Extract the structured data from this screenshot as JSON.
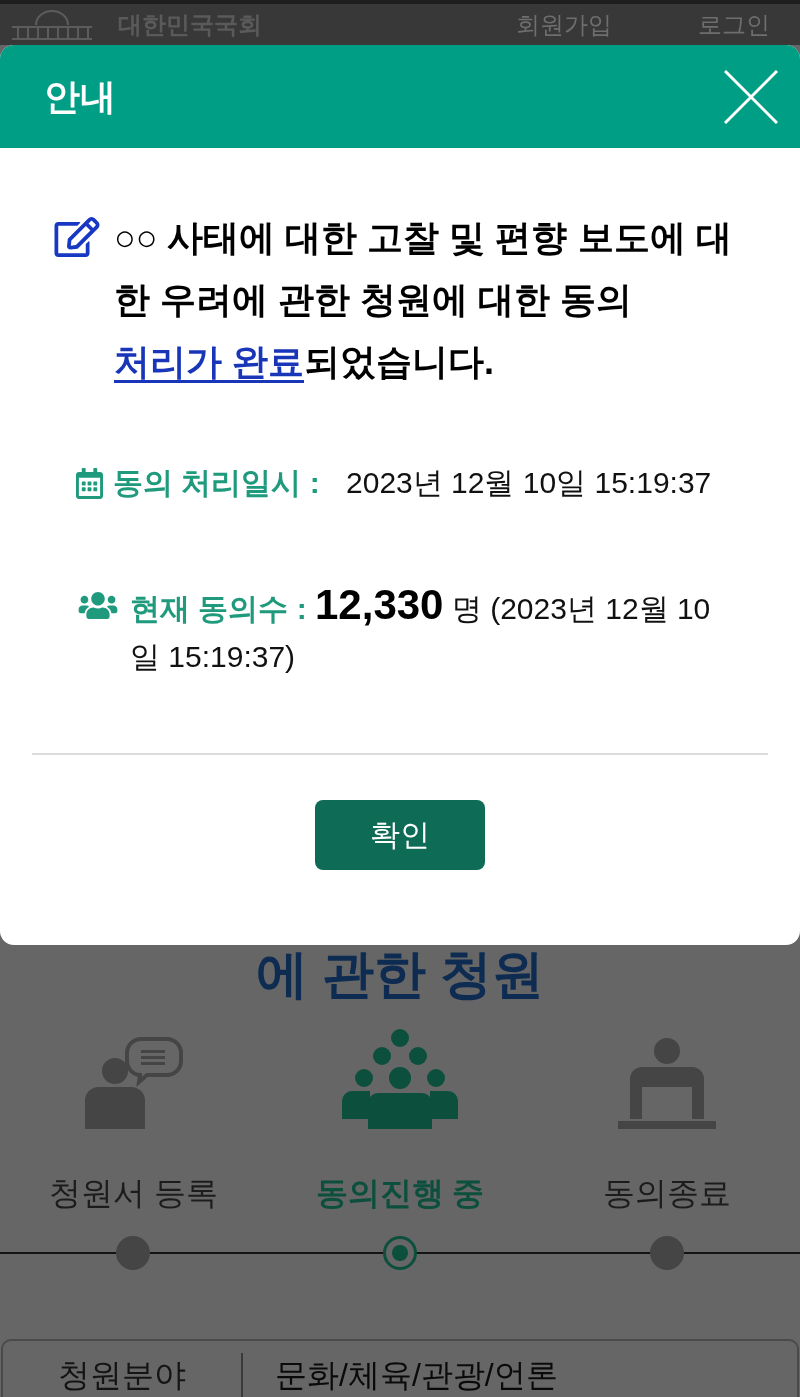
{
  "background_page": {
    "header": {
      "logo_text": "대한민국국회",
      "links": [
        "회원가입",
        "로그인"
      ]
    },
    "title_tail": "에 관한 청원",
    "steps": [
      {
        "label": "청원서 등록",
        "selected": false
      },
      {
        "label": "동의진행 중",
        "selected": true
      },
      {
        "label": "동의종료",
        "selected": false
      }
    ],
    "info_table": {
      "rows": [
        {
          "label": "청원분야",
          "value": "문화/체육/관광/언론"
        }
      ]
    }
  },
  "dialog": {
    "title": "안내",
    "message": {
      "text_before": "○○ 사태에 대한 고찰 및 편향 보도에 대한 우려에 관한 청원에 대한 동의",
      "link": "처리가 완료",
      "text_after": "되었습니다."
    },
    "details": [
      {
        "kind": "date",
        "label": "동의 처리일시 :",
        "value": "2023년 12월 10일 15:19:37"
      },
      {
        "kind": "count",
        "label": "현재 동의수 :",
        "count": "12,330",
        "unit": "명",
        "note": "(2023년 12월 10일 15:19:37)"
      }
    ],
    "confirm_button": "확인"
  }
}
